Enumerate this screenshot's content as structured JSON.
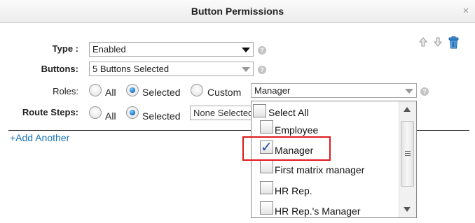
{
  "window": {
    "title": "Button Permissions",
    "close_label": "×"
  },
  "form": {
    "type": {
      "label": "Type :",
      "value": "Enabled"
    },
    "buttons": {
      "label": "Buttons:",
      "value": "5 Buttons Selected"
    },
    "roles": {
      "label": "Roles:",
      "options": [
        "All",
        "Selected",
        "Custom"
      ],
      "selected_option": "Selected",
      "dropdown_value": "Manager"
    },
    "route_steps": {
      "label": "Route Steps:",
      "options": [
        "All",
        "Selected"
      ],
      "selected_option": "Selected",
      "select_value": "None Selected"
    },
    "help_glyph": "?"
  },
  "actions": {
    "add_another": "+Add Another"
  },
  "toolbar_icons": [
    "arrow-up-icon",
    "arrow-down-icon",
    "trash-icon"
  ],
  "dropdown_list": {
    "items": [
      {
        "label": "Select All",
        "checked": false
      },
      {
        "label": "Employee",
        "checked": false
      },
      {
        "label": "Manager",
        "checked": true
      },
      {
        "label": "First matrix manager",
        "checked": false
      },
      {
        "label": "HR Rep.",
        "checked": false
      },
      {
        "label": "HR Rep.'s Manager",
        "checked": false
      }
    ],
    "check_glyph": "✓"
  },
  "colors": {
    "highlight": "#e0191e",
    "link": "#1a73b8",
    "radio_on": "#1f78c8"
  }
}
